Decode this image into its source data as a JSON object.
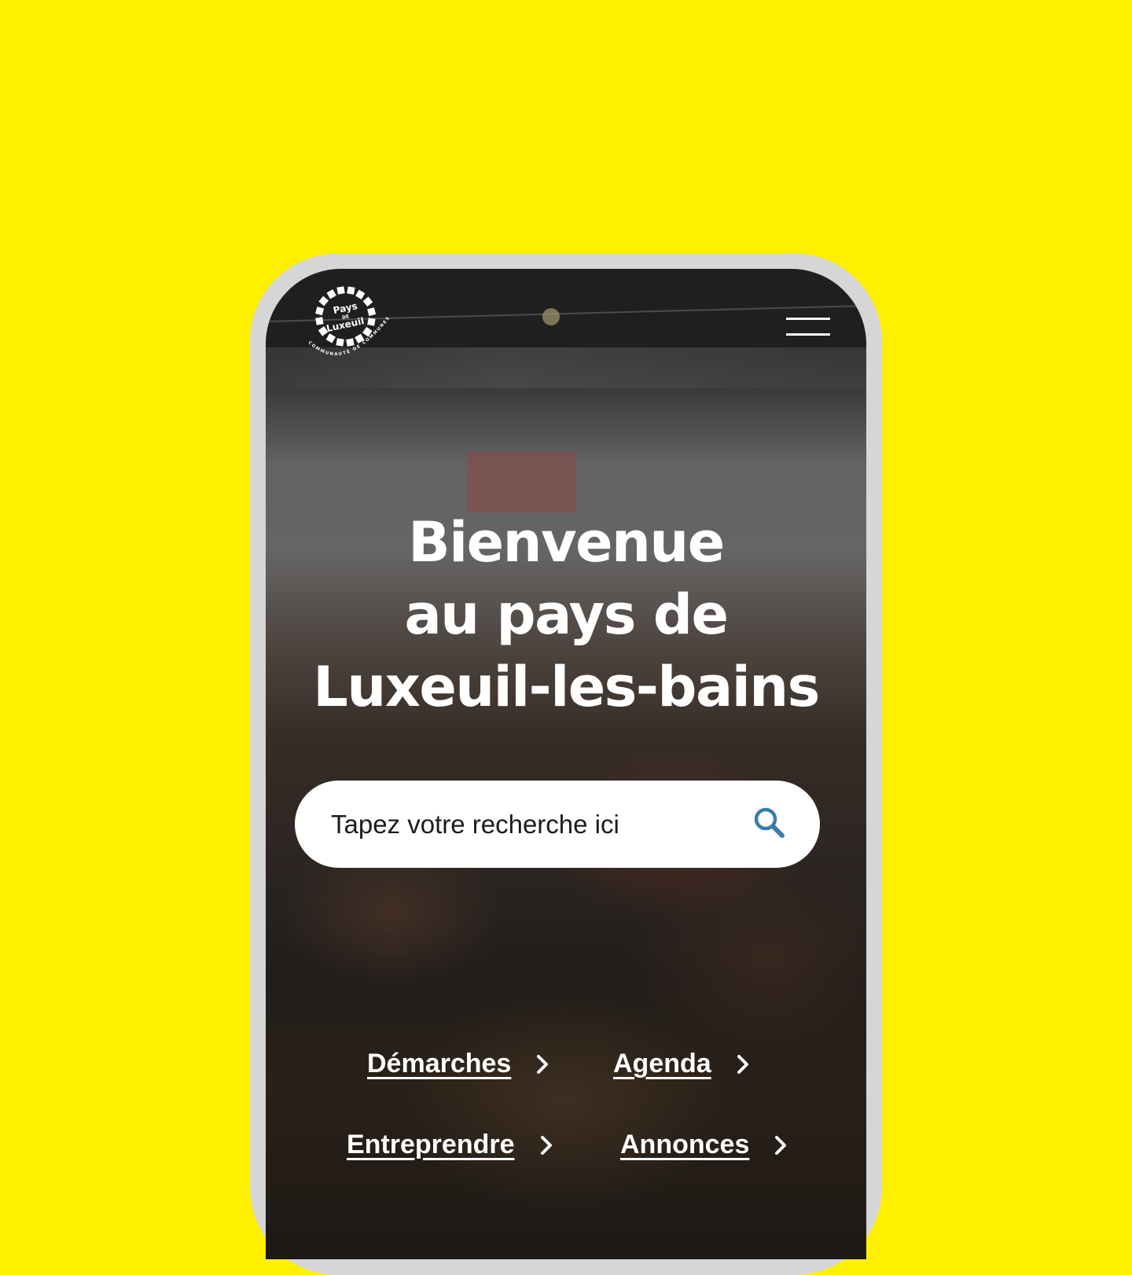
{
  "page": {
    "background_color": "#FFF000",
    "phone_frame_color": "#D6D6D6"
  },
  "header": {
    "logo_text": [
      "Pays",
      "DE",
      "Luxeuil"
    ],
    "logo_subtitle": "COMMUNAUTÉ DE COMMUNES",
    "menu_icon": "hamburger-menu-icon"
  },
  "hero": {
    "title_lines": [
      "Bienvenue",
      "au pays de",
      "Luxeuil-les-bains"
    ]
  },
  "search": {
    "placeholder": "Tapez votre recherche ici",
    "value": "",
    "icon": "search-icon",
    "icon_color": "#3C7CA8"
  },
  "quick_links": [
    {
      "label": "Démarches",
      "icon": "chevron-right-icon"
    },
    {
      "label": "Agenda",
      "icon": "chevron-right-icon"
    },
    {
      "label": "Entreprendre",
      "icon": "chevron-right-icon"
    },
    {
      "label": "Annonces",
      "icon": "chevron-right-icon"
    }
  ]
}
